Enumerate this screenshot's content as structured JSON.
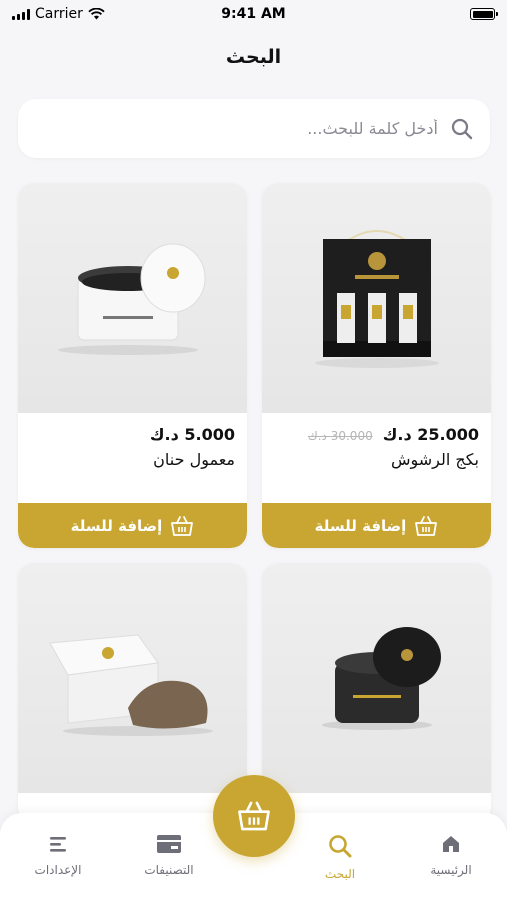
{
  "status_bar": {
    "carrier": "Carrier",
    "time": "9:41 AM"
  },
  "header": {
    "title": "البحث"
  },
  "search": {
    "placeholder": "أدخل كلمة للبحث..."
  },
  "products": [
    {
      "price": "25.000 د.ك",
      "old_price": "30.000 د.ك",
      "name": "بكج الرشوش",
      "cta": "إضافة للسلة"
    },
    {
      "price": "5.000 د.ك",
      "name": "معمول حنان",
      "cta": "إضافة للسلة"
    },
    {
      "name": "",
      "price": ""
    },
    {
      "name": "",
      "price": ""
    }
  ],
  "tabs": [
    {
      "label": "الرئيسية",
      "icon": "home-icon"
    },
    {
      "label": "البحث",
      "icon": "search-icon",
      "active": true
    },
    {
      "label": "التصنيفات",
      "icon": "categories-icon"
    },
    {
      "label": "الإعدادات",
      "icon": "settings-icon"
    }
  ],
  "colors": {
    "accent": "#c8a631",
    "background": "#f6f6f8",
    "inactive_tab": "#6e6e78"
  }
}
